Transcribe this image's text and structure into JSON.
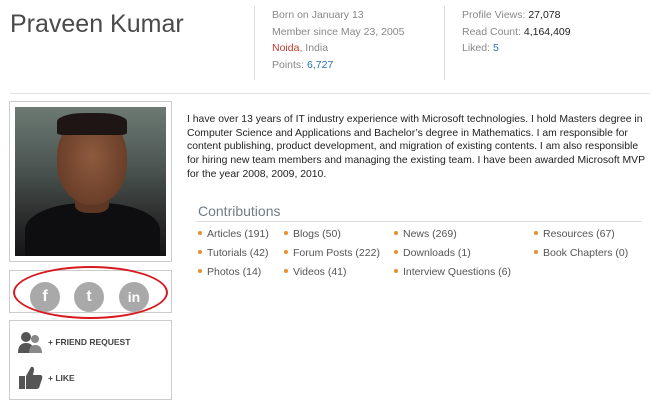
{
  "profile": {
    "name": "Praveen Kumar",
    "born": "Born on January 13",
    "member_since": "Member since May 23, 2005",
    "city": "Noida",
    "country": ", India",
    "points_label": "Points: ",
    "points_value": "6,727"
  },
  "stats": {
    "views_label": "Profile Views: ",
    "views_value": "27,078",
    "read_label": "Read Count: ",
    "read_value": "4,164,409",
    "liked_label": "Liked: ",
    "liked_value": "5"
  },
  "social": [
    {
      "icon": "facebook-icon",
      "glyph": "f"
    },
    {
      "icon": "twitter-icon",
      "glyph": "t"
    },
    {
      "icon": "linkedin-icon",
      "glyph": "in"
    }
  ],
  "actions": {
    "friend_request": "+ FRIEND REQUEST",
    "like": "+ LIKE"
  },
  "bio": "I have over 13 years of IT industry experience with Microsoft technologies. I hold Masters degree in Computer Science and Applications and Bachelor’s degree in Mathematics. I am responsible for content publishing, product development, and migration of existing contents. I am also responsible for hiring new team members and managing the existing team. I have been awarded Microsoft MVP for the year 2008, 2009, 2010.",
  "contributions": {
    "title": "Contributions",
    "items": [
      "Articles (191)",
      "Blogs (50)",
      "News (269)",
      "Resources (67)",
      "Tutorials (42)",
      "Forum Posts (222)",
      "Downloads (1)",
      "Book Chapters (0)",
      "Photos (14)",
      "Videos (41)",
      "Interview Questions (6)"
    ]
  },
  "colors": {
    "accent_red": "#d71920",
    "link_blue": "#2a6fb6",
    "bullet_orange": "#e8902a"
  }
}
